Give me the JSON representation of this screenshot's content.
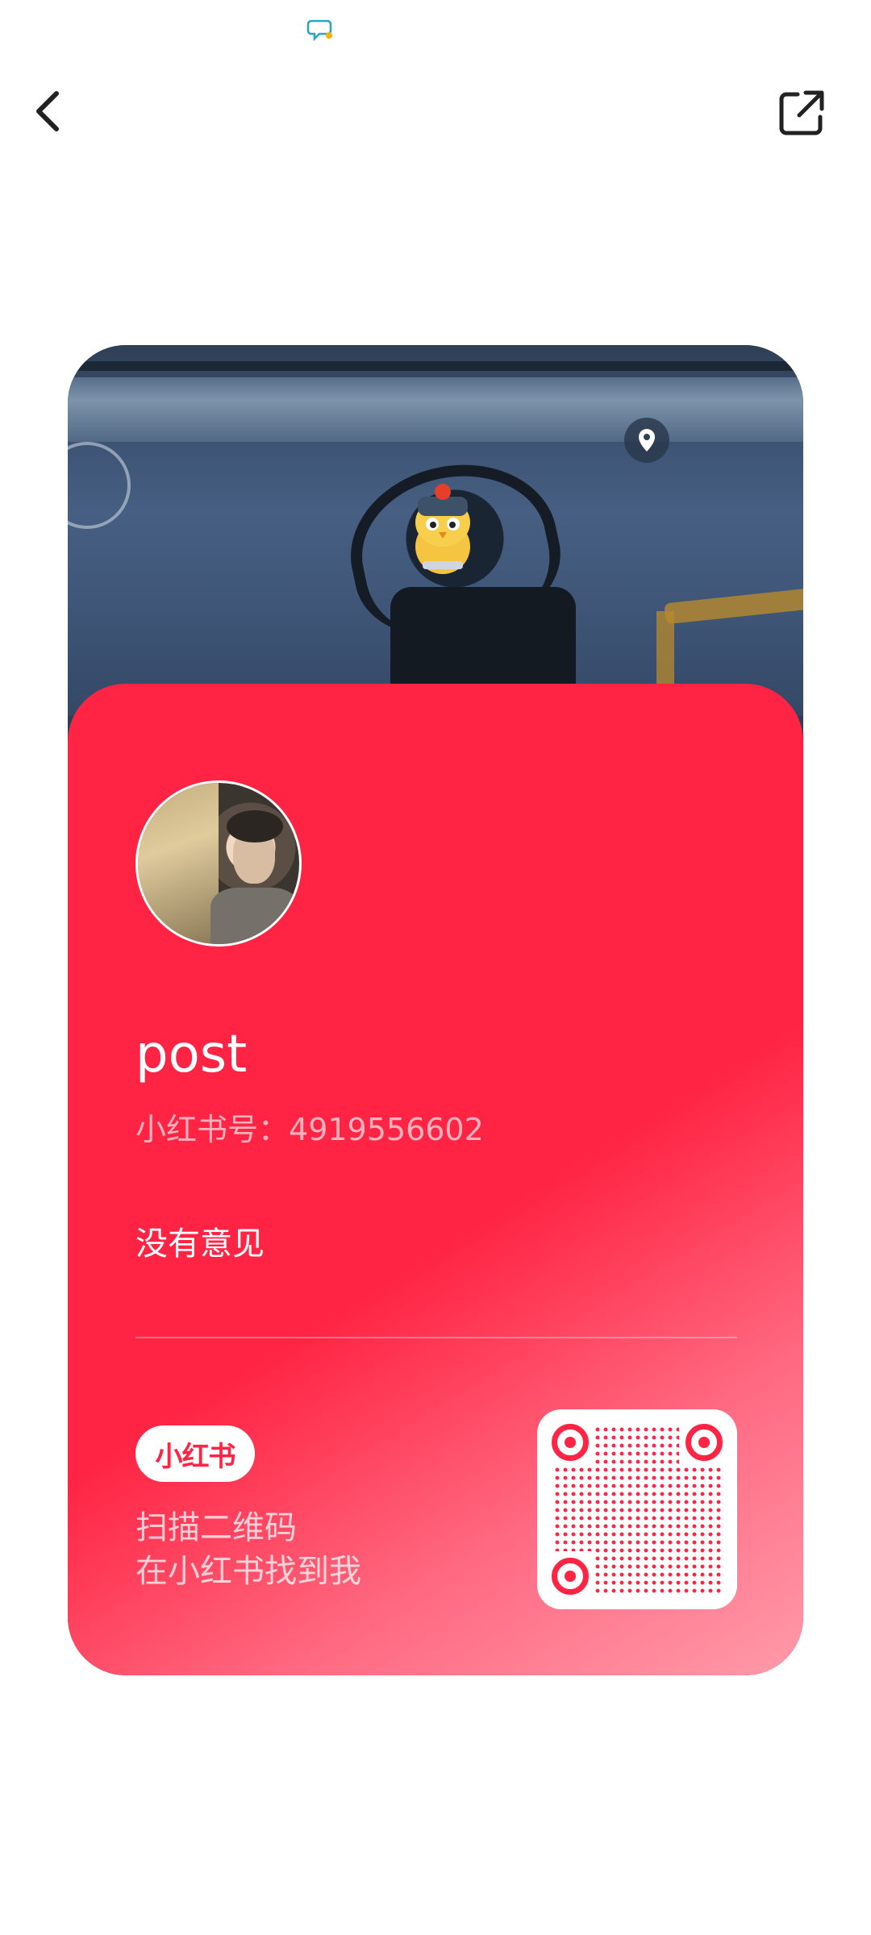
{
  "status_bar": {
    "icon": "chat-bubble-icon"
  },
  "top_bar": {
    "back_icon": "chevron-left-icon",
    "share_icon": "external-share-icon"
  },
  "card": {
    "username": "post",
    "id_label": "小红书号：",
    "id_value": "4919556602",
    "bio": "没有意见",
    "logo_text": "小红书",
    "scan_line1": "扫描二维码",
    "scan_line2": "在小红书找到我",
    "accent_color": "#ff2443"
  }
}
